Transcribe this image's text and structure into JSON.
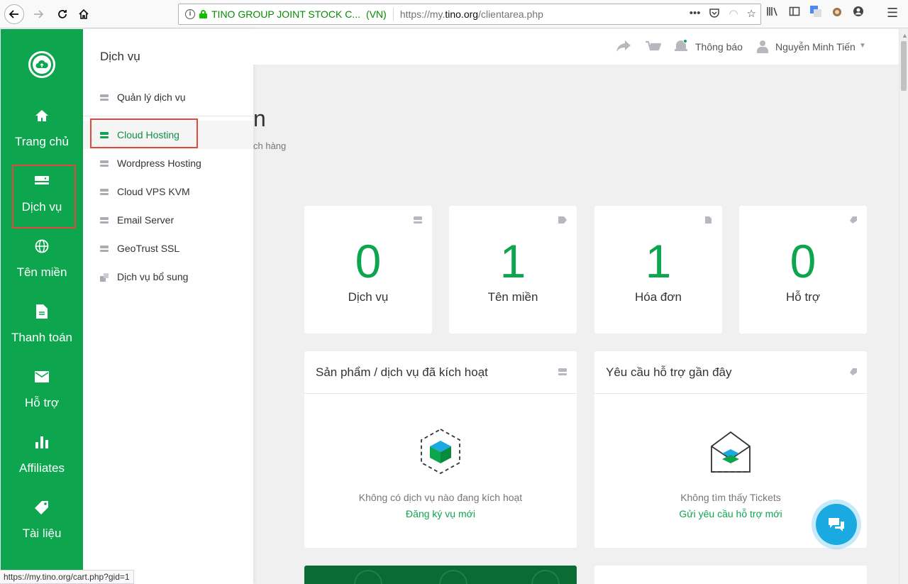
{
  "browser": {
    "site_identity": "TINO GROUP JOINT STOCK C...",
    "site_country": "(VN)",
    "url_prefix": "https://my.",
    "url_domain": "tino.org",
    "url_path": "/clientarea.php",
    "status_url": "https://my.tino.org/cart.php?gid=1"
  },
  "sidebar": {
    "logo": "cloud-upload-icon",
    "items": [
      {
        "label": "Trang chủ",
        "icon": "home-icon"
      },
      {
        "label": "Dịch vụ",
        "icon": "server-icon"
      },
      {
        "label": "Tên miền",
        "icon": "globe-icon"
      },
      {
        "label": "Thanh toán",
        "icon": "document-icon"
      },
      {
        "label": "Hỗ trợ",
        "icon": "envelope-icon"
      },
      {
        "label": "Affiliates",
        "icon": "bar-chart-icon"
      },
      {
        "label": "Tài liệu",
        "icon": "tag-icon"
      }
    ],
    "accent_color": "#0ea54f"
  },
  "flyout": {
    "title": "Dịch vụ",
    "items": [
      {
        "label": "Quản lý dịch vụ"
      },
      {
        "label": "Cloud Hosting"
      },
      {
        "label": "Wordpress Hosting"
      },
      {
        "label": "Cloud VPS KVM"
      },
      {
        "label": "Email Server"
      },
      {
        "label": "GeoTrust SSL"
      },
      {
        "label": "Dịch vụ bổ sung"
      }
    ]
  },
  "header": {
    "notifications": "Thông báo",
    "user_name": "Nguyễn Minh Tiến"
  },
  "page": {
    "title_fragment": "n",
    "subtitle_fragment": "ch hàng"
  },
  "stats": [
    {
      "value": "0",
      "label": "Dịch vụ",
      "icon": "server-icon"
    },
    {
      "value": "1",
      "label": "Tên miền",
      "icon": "tag-icon"
    },
    {
      "value": "1",
      "label": "Hóa đơn",
      "icon": "document-icon"
    },
    {
      "value": "0",
      "label": "Hỗ trợ",
      "icon": "ticket-icon"
    }
  ],
  "panels": {
    "services": {
      "title": "Sản phẩm / dịch vụ đã kích hoạt",
      "empty_text": "Không có dịch vụ nào đang kích hoạt",
      "link": "Đăng ký vụ mới"
    },
    "tickets": {
      "title": "Yêu cầu hỗ trợ gần đây",
      "empty_text": "Không tìm thấy Tickets",
      "link": "Gửi yêu cầu hỗ trợ mới"
    }
  },
  "colors": {
    "green": "#0ea54f",
    "highlight_red": "#e4473d",
    "chat_blue": "#1aa9e1"
  }
}
